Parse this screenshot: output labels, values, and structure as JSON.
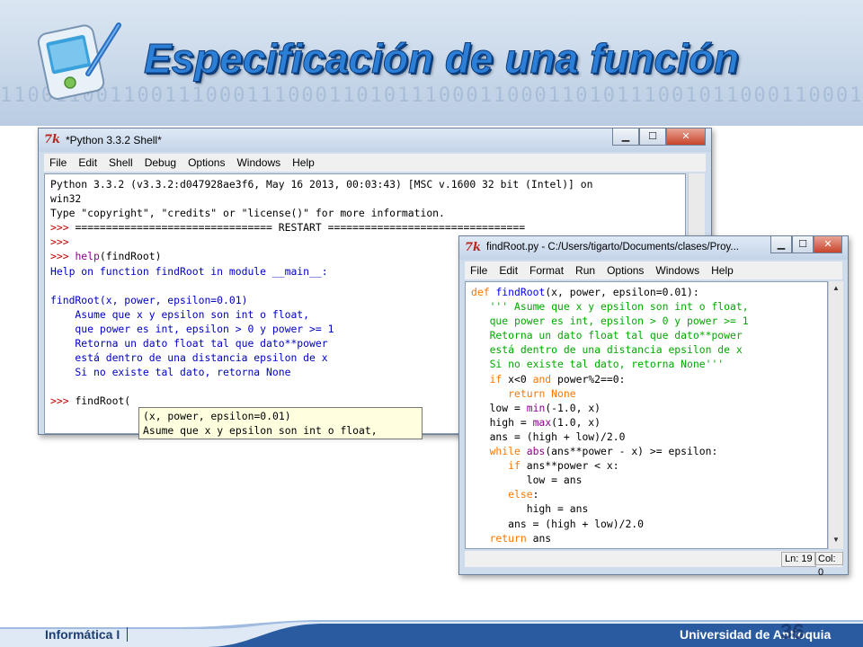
{
  "slide": {
    "title": "Especificación de una función",
    "binary_text": "1100110011001110001110001101011100011000110101110010110001100011",
    "footer_left": "Informática I",
    "footer_right": "Universidad de Antioquia",
    "page_number": "36"
  },
  "shell": {
    "title": "*Python 3.3.2 Shell*",
    "menu": [
      "File",
      "Edit",
      "Shell",
      "Debug",
      "Options",
      "Windows",
      "Help"
    ],
    "lines": [
      [
        {
          "t": "Python 3.3.2 (v3.3.2:d047928ae3f6, May 16 2013, 00:03:43) [MSC v.1600 32 bit (Intel)] on",
          "c": ""
        }
      ],
      [
        {
          "t": "win32",
          "c": ""
        }
      ],
      [
        {
          "t": "Type \"copyright\", \"credits\" or \"license()\" for more information.",
          "c": ""
        }
      ],
      [
        {
          "t": ">>> ",
          "c": "pr"
        },
        {
          "t": "================================ RESTART ================================",
          "c": ""
        }
      ],
      [
        {
          "t": ">>> ",
          "c": "pr"
        }
      ],
      [
        {
          "t": ">>> ",
          "c": "pr"
        },
        {
          "t": "help",
          "c": "bi"
        },
        {
          "t": "(findRoot)",
          "c": ""
        }
      ],
      [
        {
          "t": "Help on function findRoot in module __main__:",
          "c": "out"
        }
      ],
      [
        {
          "t": "",
          "c": ""
        }
      ],
      [
        {
          "t": "findRoot(x, power, epsilon=0.01)",
          "c": "out"
        }
      ],
      [
        {
          "t": "    Asume que x y epsilon son int o float,",
          "c": "out"
        }
      ],
      [
        {
          "t": "    que power es int, epsilon > 0 y power >= 1",
          "c": "out"
        }
      ],
      [
        {
          "t": "    Retorna un dato float tal que dato**power",
          "c": "out"
        }
      ],
      [
        {
          "t": "    está dentro de una distancia epsilon de x",
          "c": "out"
        }
      ],
      [
        {
          "t": "    Si no existe tal dato, retorna None",
          "c": "out"
        }
      ],
      [
        {
          "t": "",
          "c": ""
        }
      ],
      [
        {
          "t": ">>> ",
          "c": "pr"
        },
        {
          "t": "findRoot(",
          "c": ""
        }
      ]
    ],
    "calltip": [
      "(x, power, epsilon=0.01)",
      "Asume que x y epsilon son int o float,"
    ]
  },
  "editor": {
    "title": "findRoot.py - C:/Users/tigarto/Documents/clases/Proy...",
    "menu": [
      "File",
      "Edit",
      "Format",
      "Run",
      "Options",
      "Windows",
      "Help"
    ],
    "lines": [
      [
        {
          "t": "def ",
          "c": "kw"
        },
        {
          "t": "findRoot",
          "c": "def"
        },
        {
          "t": "(x, power, epsilon=0.01):",
          "c": ""
        }
      ],
      [
        {
          "t": "   ''' Asume que x y epsilon son int o float,",
          "c": "str"
        }
      ],
      [
        {
          "t": "   que power es int, epsilon > 0 y power >= 1",
          "c": "str"
        }
      ],
      [
        {
          "t": "   Retorna un dato float tal que dato**power",
          "c": "str"
        }
      ],
      [
        {
          "t": "   está dentro de una distancia epsilon de x",
          "c": "str"
        }
      ],
      [
        {
          "t": "   Si no existe tal dato, retorna None'''",
          "c": "str"
        }
      ],
      [
        {
          "t": "   ",
          "c": ""
        },
        {
          "t": "if",
          "c": "kw"
        },
        {
          "t": " x<0 ",
          "c": ""
        },
        {
          "t": "and",
          "c": "kw"
        },
        {
          "t": " power%2==0:",
          "c": ""
        }
      ],
      [
        {
          "t": "      ",
          "c": ""
        },
        {
          "t": "return None",
          "c": "kw"
        }
      ],
      [
        {
          "t": "   low = ",
          "c": ""
        },
        {
          "t": "min",
          "c": "bi"
        },
        {
          "t": "(-1.0, x)",
          "c": ""
        }
      ],
      [
        {
          "t": "   high = ",
          "c": ""
        },
        {
          "t": "max",
          "c": "bi"
        },
        {
          "t": "(1.0, x)",
          "c": ""
        }
      ],
      [
        {
          "t": "   ans = (high + low)/2.0",
          "c": ""
        }
      ],
      [
        {
          "t": "   ",
          "c": ""
        },
        {
          "t": "while",
          "c": "kw"
        },
        {
          "t": " ",
          "c": ""
        },
        {
          "t": "abs",
          "c": "bi"
        },
        {
          "t": "(ans**power - x) >= epsilon:",
          "c": ""
        }
      ],
      [
        {
          "t": "      ",
          "c": ""
        },
        {
          "t": "if",
          "c": "kw"
        },
        {
          "t": " ans**power < x:",
          "c": ""
        }
      ],
      [
        {
          "t": "         low = ans",
          "c": ""
        }
      ],
      [
        {
          "t": "      ",
          "c": ""
        },
        {
          "t": "else",
          "c": "kw"
        },
        {
          "t": ":",
          "c": ""
        }
      ],
      [
        {
          "t": "         high = ans",
          "c": ""
        }
      ],
      [
        {
          "t": "      ans = (high + low)/2.0",
          "c": ""
        }
      ],
      [
        {
          "t": "   ",
          "c": ""
        },
        {
          "t": "return",
          "c": "kw"
        },
        {
          "t": " ans",
          "c": ""
        }
      ]
    ],
    "status": {
      "line": "Ln: 19",
      "col": "Col: 0"
    }
  },
  "colors": {
    "keyword": "#ff7700",
    "builtin": "#900090",
    "string": "#00aa00",
    "prompt": "#c00000",
    "definition": "#0000ff",
    "output": "#0000c0",
    "title": "#2c7fd6"
  },
  "window_controls": {
    "minimize": "▁",
    "maximize": "☐",
    "close": "✕"
  }
}
